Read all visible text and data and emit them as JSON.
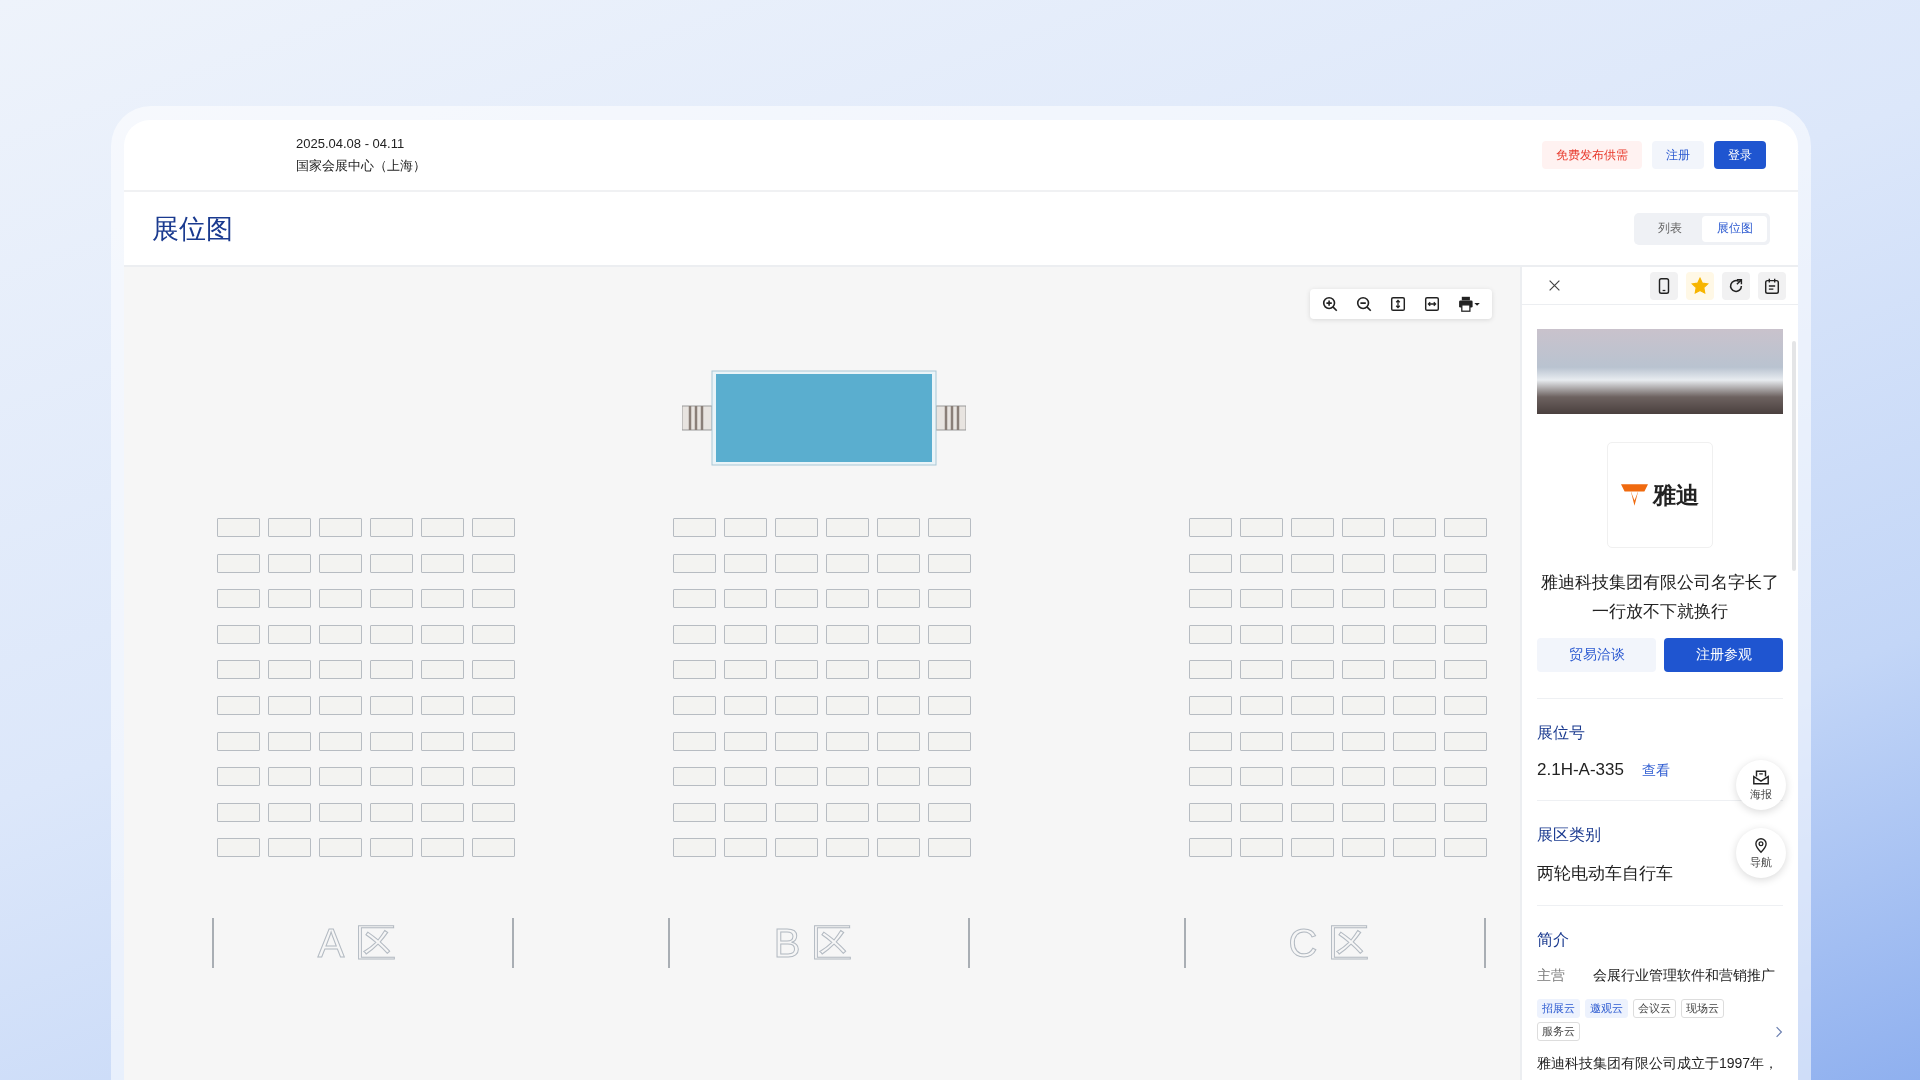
{
  "header": {
    "date": "2025.04.08 - 04.11",
    "venue": "国家会展中心（上海）",
    "buttons": [
      {
        "label": "免费发布供需",
        "kind": "danger"
      },
      {
        "label": "注册",
        "kind": "light"
      },
      {
        "label": "登录",
        "kind": "primary"
      }
    ]
  },
  "page_title": "展位图",
  "view_toggle": [
    {
      "label": "列表",
      "selected": false
    },
    {
      "label": "展位图",
      "selected": true
    }
  ],
  "zones": [
    {
      "label": "A区"
    },
    {
      "label": "B区"
    },
    {
      "label": "C区"
    }
  ],
  "panel": {
    "favorited": true,
    "logo_text": "雅迪",
    "company_name": "雅迪科技集团有限公司名字长了一行放不下就换行",
    "actions": [
      {
        "label": "贸易洽谈",
        "kind": "light"
      },
      {
        "label": "注册参观",
        "kind": "primary"
      }
    ],
    "booth": {
      "heading": "展位号",
      "value": "2.1H-A-335",
      "link": "查看"
    },
    "category": {
      "heading": "展区类别",
      "value": "两轮电动车自行车"
    },
    "float_buttons": [
      {
        "label": "海报",
        "kind": "poster"
      },
      {
        "label": "导航",
        "kind": "nav"
      }
    ],
    "intro": {
      "heading": "简介",
      "main_label": "主营",
      "main_value": "会展行业管理软件和营销推广",
      "tags": [
        {
          "label": "招展云",
          "highlighted": true
        },
        {
          "label": "邀观云",
          "highlighted": true
        },
        {
          "label": "会议云",
          "highlighted": false
        },
        {
          "label": "现场云",
          "highlighted": false
        },
        {
          "label": "服务云",
          "highlighted": false
        }
      ],
      "description": "雅迪科技集团有限公司成立于1997年，"
    }
  }
}
